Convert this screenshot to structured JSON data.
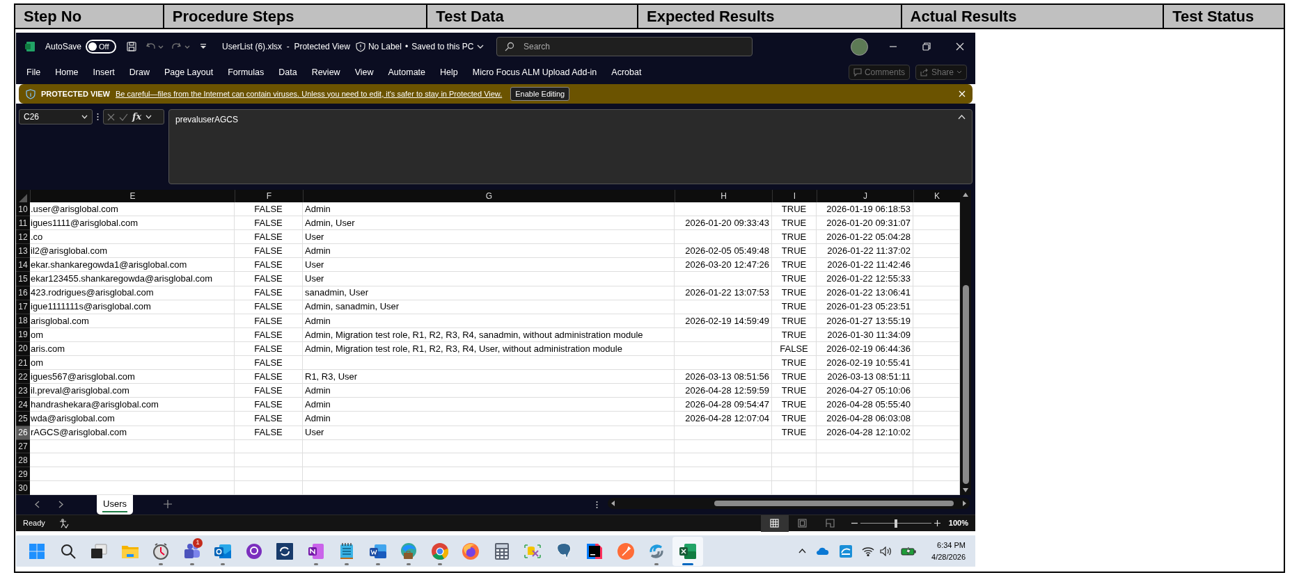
{
  "document_table": {
    "columns": [
      "Step No",
      "Procedure Steps",
      "Test Data",
      "Expected Results",
      "Actual Results",
      "Test Status"
    ]
  },
  "excel": {
    "title_bar": {
      "autosave_label": "AutoSave",
      "autosave": {
        "on": false,
        "label": "Off"
      },
      "file_title": "UserList (6).xlsx  -  Protected View",
      "sensitivity": "No Label",
      "separator": "•",
      "save_status": "Saved to this PC",
      "search_placeholder": "Search"
    },
    "ribbon_tabs": [
      "File",
      "Home",
      "Insert",
      "Draw",
      "Page Layout",
      "Formulas",
      "Data",
      "Review",
      "View",
      "Automate",
      "Help",
      "Micro Focus ALM Upload Add-in",
      "Acrobat"
    ],
    "ribbon_buttons": [
      {
        "kind": "comments",
        "label": "Comments",
        "disabled": true
      },
      {
        "kind": "share",
        "label": "Share",
        "disabled": true
      }
    ],
    "protected_view": {
      "title": "PROTECTED VIEW",
      "message": "Be careful—files from the Internet can contain viruses. Unless you need to edit, it's safer to stay in Protected View.",
      "button": "Enable Editing"
    },
    "formula_bar": {
      "name_box": "C26",
      "fx": "fx",
      "value": "prevaluserAGCS"
    },
    "sheet": {
      "columns": [
        "E",
        "F",
        "G",
        "H",
        "I",
        "J",
        "K"
      ],
      "rows": [
        {
          "number": "10",
          "selected": false,
          "e": ".user@arisglobal.com",
          "f": "FALSE",
          "g": "Admin",
          "i": "TRUE",
          "j": "2026-01-19 06:18:53"
        },
        {
          "number": "11",
          "selected": false,
          "e": "igues1111@arisglobal.com",
          "f": "FALSE",
          "g": "Admin, User",
          "h": "2026-01-20 09:33:43",
          "i": "TRUE",
          "j": "2026-01-20 09:31:07"
        },
        {
          "number": "12",
          "selected": false,
          "e": ".co",
          "f": "FALSE",
          "g": "User",
          "i": "TRUE",
          "j": "2026-01-22 05:04:28"
        },
        {
          "number": "13",
          "selected": false,
          "e": "il2@arisglobal.com",
          "f": "FALSE",
          "g": "Admin",
          "h": "2026-02-05 05:49:48",
          "i": "TRUE",
          "j": "2026-01-22 11:37:02"
        },
        {
          "number": "14",
          "selected": false,
          "e": "ekar.shankaregowda1@arisglobal.com",
          "f": "FALSE",
          "g": "User",
          "h": "2026-03-20 12:47:26",
          "i": "TRUE",
          "j": "2026-01-22 11:42:46"
        },
        {
          "number": "15",
          "selected": false,
          "e": "ekar123455.shankaregowda@arisglobal.com",
          "f": "FALSE",
          "g": "User",
          "i": "TRUE",
          "j": "2026-01-22 12:55:33"
        },
        {
          "number": "16",
          "selected": false,
          "e": "423.rodrigues@arisglobal.com",
          "f": "FALSE",
          "g": "sanadmin, User",
          "h": "2026-01-22 13:07:53",
          "i": "TRUE",
          "j": "2026-01-22 13:06:41"
        },
        {
          "number": "17",
          "selected": false,
          "e": "igue1111111s@arisglobal.com",
          "f": "FALSE",
          "g": "Admin, sanadmin, User",
          "i": "TRUE",
          "j": "2026-01-23 05:23:51"
        },
        {
          "number": "18",
          "selected": false,
          "e": "arisglobal.com",
          "f": "FALSE",
          "g": "Admin",
          "h": "2026-02-19 14:59:49",
          "i": "TRUE",
          "j": "2026-01-27 13:55:19"
        },
        {
          "number": "19",
          "selected": false,
          "e": "om",
          "f": "FALSE",
          "g": "Admin, Migration test role, R1, R2, R3, R4, sanadmin, without administration module",
          "i": "TRUE",
          "j": "2026-01-30 11:34:09"
        },
        {
          "number": "20",
          "selected": false,
          "e": "aris.com",
          "f": "FALSE",
          "g": "Admin, Migration test role, R1, R2, R3, R4, User, without administration module",
          "i": "FALSE",
          "j": "2026-02-19 06:44:36"
        },
        {
          "number": "21",
          "selected": false,
          "e": "om",
          "f": "FALSE",
          "i": "TRUE",
          "j": "2026-02-19 10:55:41"
        },
        {
          "number": "22",
          "selected": false,
          "e": "igues567@arisglobal.com",
          "f": "FALSE",
          "g": "R1, R3, User",
          "h": "2026-03-13 08:51:56",
          "i": "TRUE",
          "j": "2026-03-13 08:51:11"
        },
        {
          "number": "23",
          "selected": false,
          "e": "il.preval@arisglobal.com",
          "f": "FALSE",
          "g": "Admin",
          "h": "2026-04-28 12:59:59",
          "i": "TRUE",
          "j": "2026-04-27 05:10:06"
        },
        {
          "number": "24",
          "selected": false,
          "e": "handrashekara@arisglobal.com",
          "f": "FALSE",
          "g": "Admin",
          "h": "2026-04-28 09:54:47",
          "i": "TRUE",
          "j": "2026-04-28 05:55:40"
        },
        {
          "number": "25",
          "selected": false,
          "e": "wda@arisglobal.com",
          "f": "FALSE",
          "g": "Admin",
          "h": "2026-04-28 12:07:04",
          "i": "TRUE",
          "j": "2026-04-28 06:03:08"
        },
        {
          "number": "26",
          "selected": true,
          "e": "rAGCS@arisglobal.com",
          "f": "FALSE",
          "g": "User",
          "i": "TRUE",
          "j": "2026-04-28 12:10:02"
        },
        {
          "number": "27",
          "selected": false
        },
        {
          "number": "28",
          "selected": false
        },
        {
          "number": "29",
          "selected": false
        },
        {
          "number": "30",
          "selected": false
        }
      ]
    },
    "sheet_tabs": [
      {
        "label": "Users",
        "selected": true
      }
    ],
    "status_bar": {
      "status": "Ready",
      "views": [
        {
          "kind": "normal",
          "selected": true
        },
        {
          "kind": "page-layout",
          "selected": false
        },
        {
          "kind": "page-break",
          "selected": false
        }
      ],
      "zoom": {
        "level": 0.5,
        "reading": "100%"
      }
    }
  },
  "taskbar": {
    "apps": [
      {
        "running": false,
        "active": false
      },
      {
        "running": false,
        "active": false
      },
      {
        "running": false,
        "active": false
      },
      {
        "running": false,
        "active": false
      },
      {
        "running": true,
        "active": false
      },
      {
        "running": true,
        "active": false,
        "badge": "1"
      },
      {
        "running": true,
        "active": false
      },
      {
        "running": false,
        "active": false
      },
      {
        "running": false,
        "active": false
      },
      {
        "running": true,
        "active": false
      },
      {
        "running": true,
        "active": false
      },
      {
        "running": true,
        "active": false
      },
      {
        "running": true,
        "active": false
      },
      {
        "running": true,
        "active": false
      },
      {
        "running": false,
        "active": false
      },
      {
        "running": false,
        "active": false
      },
      {
        "running": false,
        "active": false
      },
      {
        "running": false,
        "active": false
      },
      {
        "running": false,
        "active": false
      },
      {
        "running": false,
        "active": false
      },
      {
        "running": true,
        "active": false
      },
      {
        "running": true,
        "active": true
      }
    ],
    "time": "6:34 PM",
    "date": "4/28/2026"
  }
}
